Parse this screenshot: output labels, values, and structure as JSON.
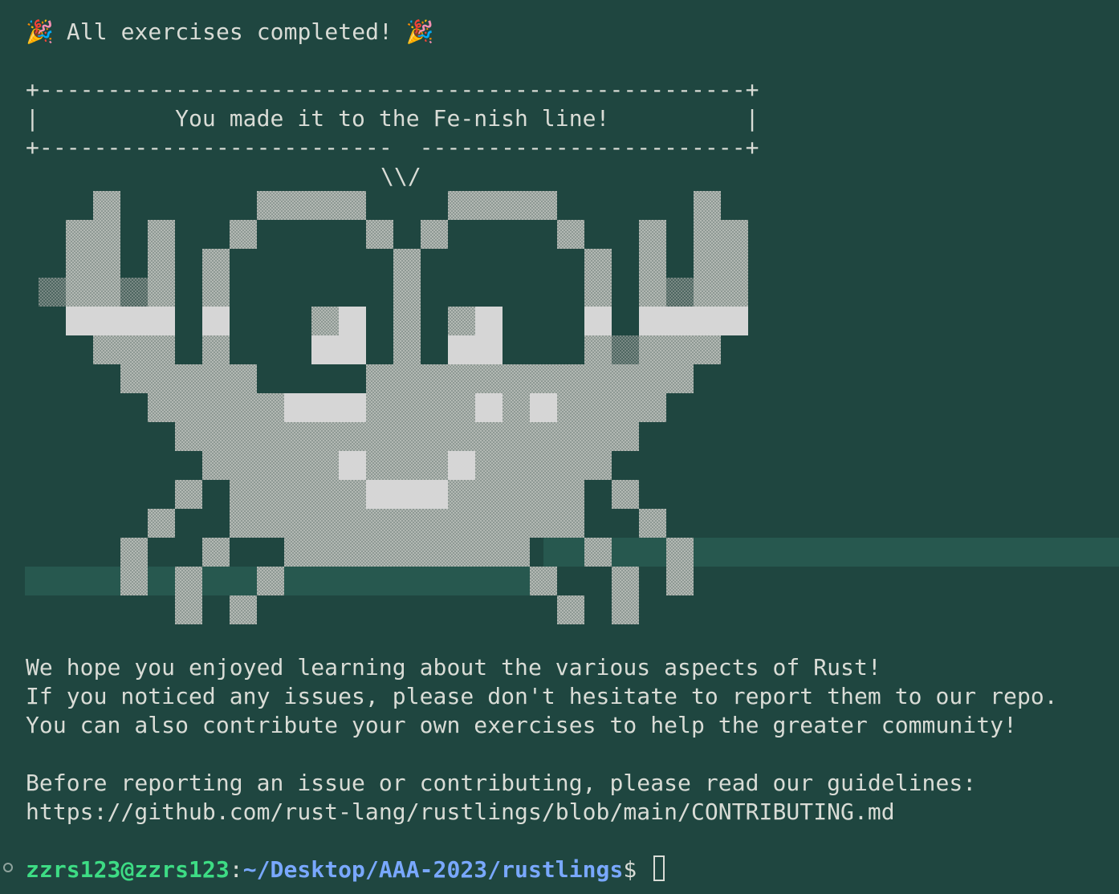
{
  "terminal": {
    "heading": "All exercises completed!",
    "party_emoji": "🎉",
    "banner": {
      "top": "+----------------------------------------------------+",
      "middle": "|          You made it to the Fe-nish line!          |",
      "bottom": "+--------------------------  ------------------------+",
      "tail": "\\\\/"
    },
    "messages": [
      "We hope you enjoyed learning about the various aspects of Rust!",
      "If you noticed any issues, please don't hesitate to report them to our repo.",
      "You can also contribute your own exercises to help the greater community!"
    ],
    "guidelines": [
      "Before reporting an issue or contributing, please read our guidelines:",
      "https://github.com/rust-lang/rustlings/blob/main/CONTRIBUTING.md"
    ],
    "prompt": {
      "user_host": "zzrs123@zzrs123",
      "colon": ":",
      "path": "~/Desktop/AAA-2023/rustlings",
      "symbol": "$ "
    }
  },
  "colors": {
    "background": "#1f4640",
    "foreground": "#d9dcd6",
    "shade_light": "#d6d6d6",
    "shade_medium": "#a9b0ab",
    "shade_dark": "#7d8a85",
    "highlight_band": "#27584f",
    "prompt_user": "#3ddc84",
    "prompt_path": "#79a8ff"
  }
}
